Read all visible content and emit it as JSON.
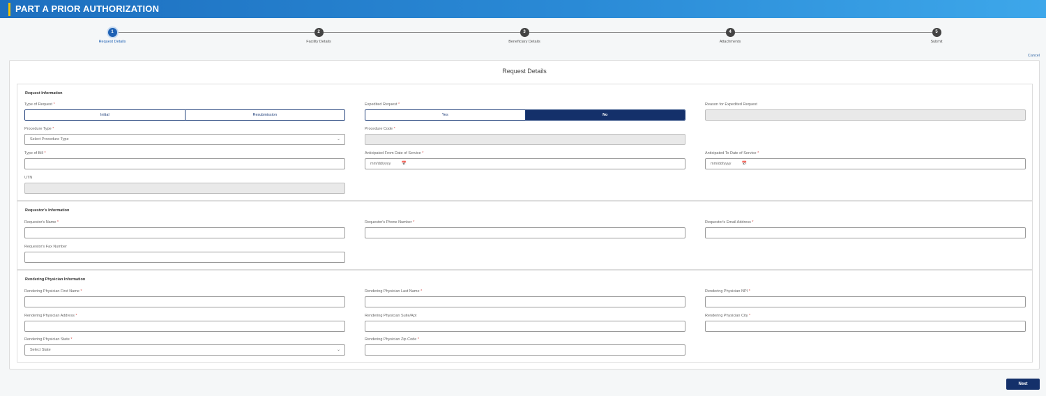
{
  "header": {
    "title": "PART A PRIOR AUTHORIZATION"
  },
  "stepper": {
    "steps": [
      {
        "number": "1",
        "label": "Request Details"
      },
      {
        "number": "2",
        "label": "Facility Details"
      },
      {
        "number": "3",
        "label": "Beneficiary Details"
      },
      {
        "number": "4",
        "label": "Attachments"
      },
      {
        "number": "5",
        "label": "Submit"
      }
    ]
  },
  "cancel_label": "Cancel",
  "card_title": "Request Details",
  "request_info": {
    "title": "Request Information",
    "type_of_request": {
      "label": "Type of Request",
      "options": [
        "Initial",
        "Resubmission"
      ]
    },
    "expedited_request": {
      "label": "Expedited Request",
      "options": [
        "Yes",
        "No"
      ],
      "selected": "No"
    },
    "reason_expedited": {
      "label": "Reason for Expedited Request"
    },
    "procedure_type": {
      "label": "Procedure Type",
      "placeholder": "Select Procedure Type"
    },
    "procedure_code": {
      "label": "Procedure Code"
    },
    "type_of_bill": {
      "label": "Type of Bill"
    },
    "from_date": {
      "label": "Anticipated From Date of Service",
      "placeholder": "mm/dd/yyyy"
    },
    "to_date": {
      "label": "Anticipated To Date of Service",
      "placeholder": "mm/dd/yyyy"
    },
    "utn": {
      "label": "UTN"
    }
  },
  "requestor_info": {
    "title": "Requestor's Information",
    "name": {
      "label": "Requestor's Name"
    },
    "phone": {
      "label": "Requestor's Phone Number"
    },
    "email": {
      "label": "Requestor's Email Address"
    },
    "fax": {
      "label": "Requestor's Fax Number"
    }
  },
  "physician_info": {
    "title": "Rendering Physician Information",
    "first_name": {
      "label": "Rendering Physician First Name"
    },
    "last_name": {
      "label": "Rendering Physician Last Name"
    },
    "npi": {
      "label": "Rendering Physician NPI"
    },
    "address": {
      "label": "Rendering Physician Address"
    },
    "suite": {
      "label": "Rendering Physician Suite/Apt"
    },
    "city": {
      "label": "Rendering Physician City"
    },
    "state": {
      "label": "Rendering Physician State",
      "placeholder": "Select State"
    },
    "zip": {
      "label": "Rendering Physician Zip Code"
    }
  },
  "required_marker": "*",
  "next_label": "Next"
}
